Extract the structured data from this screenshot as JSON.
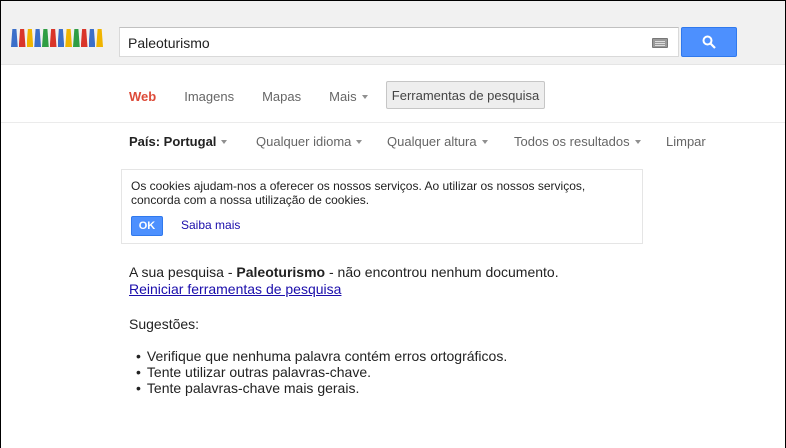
{
  "search": {
    "query": "Paleoturismo"
  },
  "logo": {
    "colors": [
      "#3b6fc9",
      "#d9352a",
      "#f0b400",
      "#3b6fc9",
      "#2f9e44",
      "#d9352a",
      "#3b6fc9",
      "#f0b400",
      "#2f9e44",
      "#d9352a",
      "#3b6fc9",
      "#f0b400"
    ]
  },
  "tabs": [
    {
      "label": "Web"
    },
    {
      "label": "Imagens"
    },
    {
      "label": "Mapas"
    },
    {
      "label": "Mais"
    }
  ],
  "tools_label": "Ferramentas de pesquisa",
  "filters": {
    "country": "País: Portugal",
    "language": "Qualquer idioma",
    "time": "Qualquer altura",
    "results": "Todos os resultados",
    "clear": "Limpar"
  },
  "cookie": {
    "message": "Os cookies ajudam-nos a oferecer os nossos serviços. Ao utilizar os nossos serviços, concorda com a nossa utilização de cookies.",
    "ok_label": "OK",
    "learn_more": "Saiba mais"
  },
  "result": {
    "prefix": "A sua pesquisa - ",
    "query": "Paleoturismo",
    "suffix": " - não encontrou nenhum documento.",
    "reset_link": "Reiniciar ferramentas de pesquisa"
  },
  "suggestions": {
    "title": "Sugestões:",
    "items": [
      "Verifique que nenhuma palavra contém erros ortográficos.",
      "Tente utilizar outras palavras-chave.",
      "Tente palavras-chave mais gerais."
    ]
  },
  "colors": {
    "accent_blue": "#4d90fe",
    "active_tab": "#dd4b39",
    "link": "#1a0dab"
  }
}
